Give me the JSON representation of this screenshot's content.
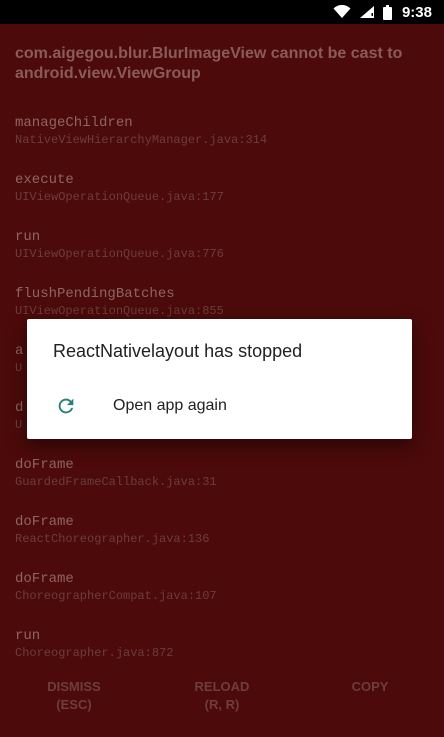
{
  "status_bar": {
    "time": "9:38",
    "icons": [
      "wifi-icon",
      "signal-icon",
      "battery-icon"
    ]
  },
  "redbox": {
    "error_message": "com.aigegou.blur.BlurImageView cannot be cast to android.view.ViewGroup",
    "stack": [
      {
        "method": "manageChildren",
        "file": "NativeViewHierarchyManager.java:314"
      },
      {
        "method": "execute",
        "file": "UIViewOperationQueue.java:177"
      },
      {
        "method": "run",
        "file": "UIViewOperationQueue.java:776"
      },
      {
        "method": "flushPendingBatches",
        "file": "UIViewOperationQueue.java:855"
      },
      {
        "method": "a",
        "file": "U"
      },
      {
        "method": "d",
        "file": "U"
      },
      {
        "method": "doFrame",
        "file": "GuardedFrameCallback.java:31"
      },
      {
        "method": "doFrame",
        "file": "ReactChoreographer.java:136"
      },
      {
        "method": "doFrame",
        "file": "ChoreographerCompat.java:107"
      },
      {
        "method": "run",
        "file": "Choreographer.java:872"
      }
    ],
    "footer": {
      "dismiss_label": "DISMISS",
      "dismiss_hint": "(ESC)",
      "reload_label": "RELOAD",
      "reload_hint": "(R, R)",
      "copy_label": "COPY"
    }
  },
  "dialog": {
    "title": "ReactNativelayout has stopped",
    "action_label": "Open app again",
    "action_icon": "reload-icon",
    "accent_color": "#26807a"
  },
  "colors": {
    "redbox_background": "#4d0a0a",
    "status_bar_background": "#000000",
    "dialog_background": "#ffffff"
  }
}
